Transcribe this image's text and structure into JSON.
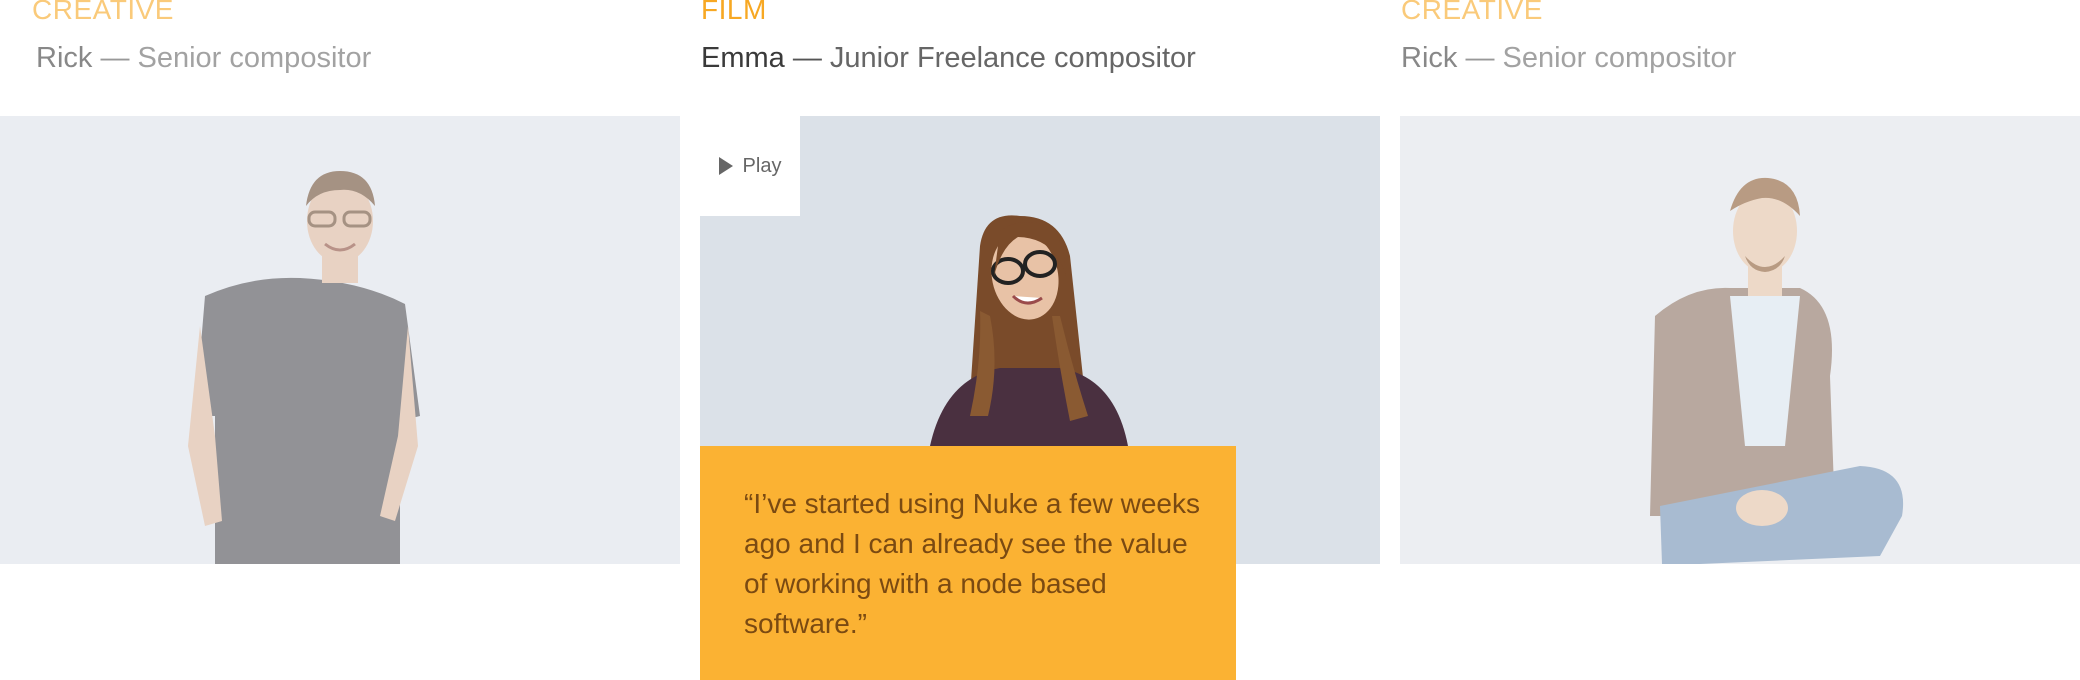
{
  "cards": [
    {
      "category": "CREATIVE",
      "name": "Rick",
      "separator": "—",
      "role": "Senior compositor",
      "photo_desc": "man-grey-tshirt-icon"
    },
    {
      "category": "FILM",
      "name": "Emma",
      "separator": "—",
      "role": "Junior Freelance compositor",
      "play_label": "Play",
      "quote": "“I’ve started using Nuke a few weeks ago and I can already see the value of working with a node based software.”"
    },
    {
      "category": "CREATIVE",
      "name": "Rick",
      "separator": "—",
      "role": "Senior compositor"
    }
  ],
  "colors": {
    "accent": "#f7a823",
    "quote_bg": "#fbb233",
    "photo_bg": "#dbe1e8"
  }
}
